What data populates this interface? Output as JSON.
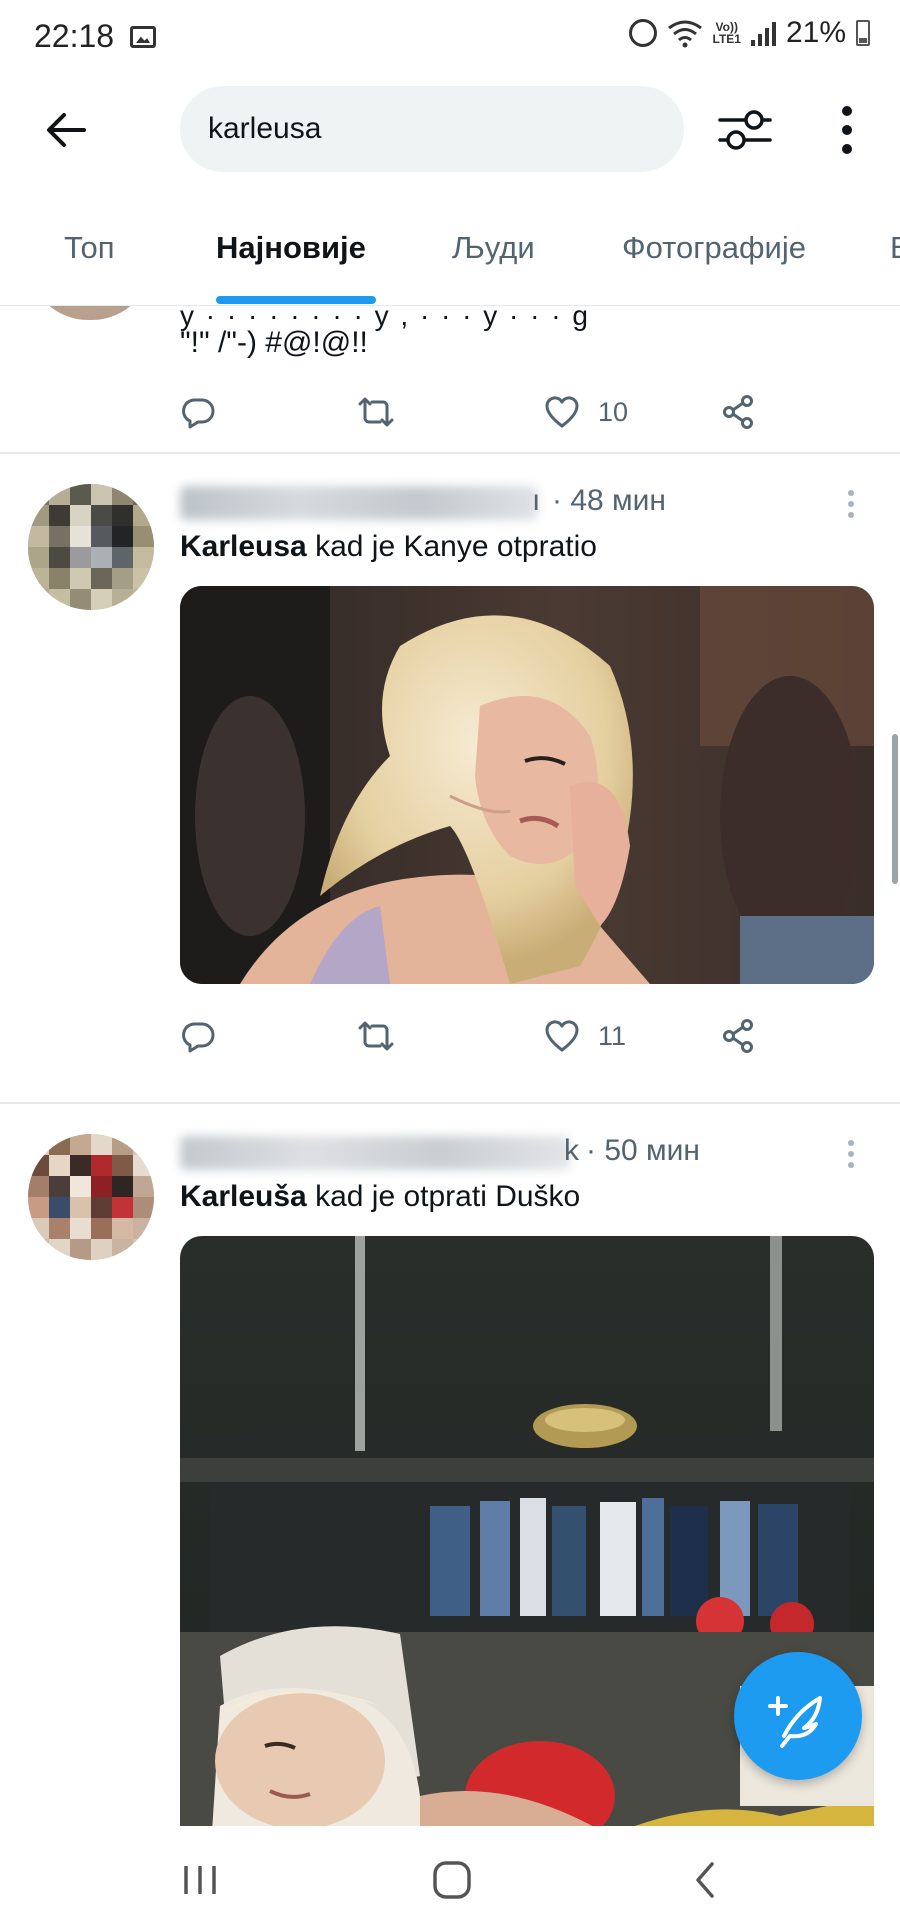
{
  "status_bar": {
    "time": "22:18",
    "battery": "21%",
    "network_label_top": "Vo))",
    "network_label_bottom": "LTE1",
    "icons": [
      "gallery-icon",
      "alarm-icon",
      "wifi-icon",
      "signal-icon",
      "battery-icon"
    ]
  },
  "search": {
    "query": "karleusa",
    "icons": [
      "back-arrow-icon",
      "filter-sliders-icon",
      "more-vertical-icon"
    ]
  },
  "tabs": [
    {
      "label": "Топ",
      "active": false
    },
    {
      "label": "Најновије",
      "active": true
    },
    {
      "label": "Људи",
      "active": false
    },
    {
      "label": "Фотографије",
      "active": false
    },
    {
      "label": "В",
      "active": false
    }
  ],
  "tweets": {
    "partial": {
      "text": "\"!\" /\"-) #@!@!!",
      "actions": {
        "reply": "",
        "retweet": "",
        "likes": "10"
      }
    },
    "tweet1": {
      "handle_tail": "ı",
      "time": "· 48 мин",
      "bold": "Karleusa",
      "text": " kad je Kanye otpratio",
      "actions": {
        "likes": "11"
      }
    },
    "tweet2": {
      "handle_tail": "k",
      "time": "· 50 мин",
      "bold": "Karleuša",
      "text": " kad je otprati Duško"
    }
  },
  "colors": {
    "accent": "#1d9bf0",
    "text": "#0f1419",
    "secondary": "#536471",
    "divider": "#e6e9ea",
    "search_bg": "#eff3f4"
  },
  "fab": {
    "icon": "compose-tweet-icon"
  },
  "nav": {
    "icons": [
      "recent-apps-icon",
      "home-icon",
      "back-icon"
    ]
  }
}
